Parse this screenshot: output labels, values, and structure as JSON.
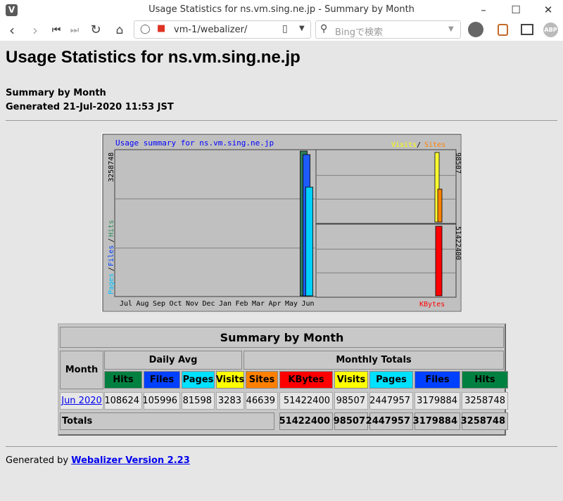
{
  "browser": {
    "app_icon": "V",
    "window_title": "Usage Statistics for ns.vm.sing.ne.jp - Summary by Month",
    "url": "vm-1/webalizer/",
    "search_placeholder": "Bingで検索",
    "abp_label": "ABP"
  },
  "page": {
    "title": "Usage Statistics for ns.vm.sing.ne.jp",
    "subtitle": "Summary by Month",
    "generated": "Generated 21-Jul-2020 11:53 JST"
  },
  "chart_data": {
    "type": "bar",
    "title": "Usage summary for ns.vm.sing.ne.jp",
    "categories": [
      "Jul",
      "Aug",
      "Sep",
      "Oct",
      "Nov",
      "Dec",
      "Jan",
      "Feb",
      "Mar",
      "Apr",
      "May",
      "Jun"
    ],
    "left_panel": {
      "max_label": "3258748",
      "ymax": 3258748,
      "legend": [
        "Pages",
        "Files",
        "Hits"
      ],
      "series": [
        {
          "name": "Hits",
          "color": "#2e7d5b",
          "values": [
            0,
            0,
            0,
            0,
            0,
            0,
            0,
            0,
            0,
            0,
            0,
            3258748
          ]
        },
        {
          "name": "Files",
          "color": "#1e5bff",
          "values": [
            0,
            0,
            0,
            0,
            0,
            0,
            0,
            0,
            0,
            0,
            0,
            3179884
          ]
        },
        {
          "name": "Pages",
          "color": "#00d0ff",
          "values": [
            0,
            0,
            0,
            0,
            0,
            0,
            0,
            0,
            0,
            0,
            0,
            2447957
          ]
        }
      ]
    },
    "right_top_panel": {
      "max_label": "98507",
      "ymax": 98507,
      "legend": [
        "Visits",
        "Sites"
      ],
      "series": [
        {
          "name": "Visits",
          "color": "#ffff33",
          "values": [
            98507
          ]
        },
        {
          "name": "Sites",
          "color": "#ff8000",
          "values": [
            46639
          ]
        }
      ]
    },
    "right_bottom_panel": {
      "max_label": "51422400",
      "ymax": 51422400,
      "legend": [
        "KBytes"
      ],
      "series": [
        {
          "name": "KBytes",
          "color": "#ff0000",
          "values": [
            51422400
          ]
        }
      ]
    }
  },
  "table": {
    "title": "Summary by Month",
    "month_label": "Month",
    "daily_avg_label": "Daily Avg",
    "monthly_totals_label": "Monthly Totals",
    "daily_cols": [
      {
        "label": "Hits",
        "color": "#008040",
        "text": "#000000"
      },
      {
        "label": "Files",
        "color": "#0040ff",
        "text": "#000000"
      },
      {
        "label": "Pages",
        "color": "#00e0ff",
        "text": "#000000"
      },
      {
        "label": "Visits",
        "color": "#ffff00",
        "text": "#000000"
      }
    ],
    "total_cols": [
      {
        "label": "Sites",
        "color": "#ff8000",
        "text": "#000000"
      },
      {
        "label": "KBytes",
        "color": "#ff0000",
        "text": "#000000"
      },
      {
        "label": "Visits",
        "color": "#ffff00",
        "text": "#000000"
      },
      {
        "label": "Pages",
        "color": "#00e0ff",
        "text": "#000000"
      },
      {
        "label": "Files",
        "color": "#0040ff",
        "text": "#000000"
      },
      {
        "label": "Hits",
        "color": "#008040",
        "text": "#000000"
      }
    ],
    "rows": [
      {
        "month": "Jun 2020",
        "values": [
          "108624",
          "105996",
          "81598",
          "3283",
          "46639",
          "51422400",
          "98507",
          "2447957",
          "3179884",
          "3258748"
        ]
      }
    ],
    "totals_label": "Totals",
    "totals": [
      "51422400",
      "98507",
      "2447957",
      "3179884",
      "3258748"
    ]
  },
  "footer": {
    "prefix": "Generated by ",
    "link": "Webalizer Version 2.23"
  }
}
